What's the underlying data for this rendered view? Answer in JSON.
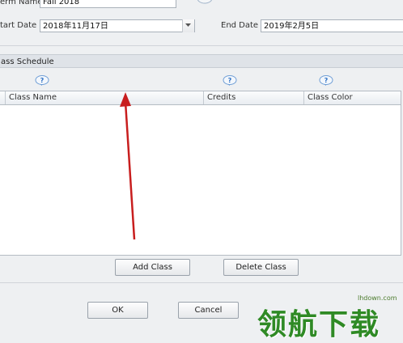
{
  "term": {
    "name_label": "erm Name",
    "name_value": "Fall 2018",
    "start_label": "tart Date",
    "start_value": "2018年11月17日",
    "end_label": "End Date",
    "end_value": "2019年2月5日"
  },
  "schedule": {
    "header": "ass Schedule",
    "columns": [
      "Class Name",
      "Credits",
      "Class Color"
    ]
  },
  "buttons": {
    "add_class": "Add Class",
    "delete_class": "Delete Class",
    "ok": "OK",
    "cancel": "Cancel"
  },
  "watermark": {
    "site": "lhdown.com",
    "brand": "领航下载"
  },
  "colors": {
    "arrow": "#c81e1e",
    "help_icon": "#2a6fc4"
  }
}
